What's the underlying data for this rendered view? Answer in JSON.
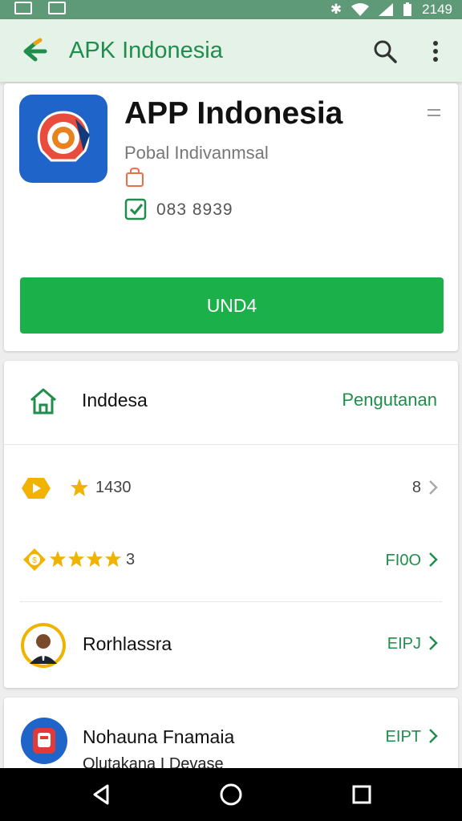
{
  "status_bar": {
    "time": "2149"
  },
  "app_bar": {
    "title": "APK Indonesia"
  },
  "app": {
    "name": "APP Indonesia",
    "publisher": "Pobal Indivanmsal",
    "size": "083 8939",
    "install_label": "UND4"
  },
  "list": {
    "header": {
      "label": "Inddesa",
      "link": "Pengutanan"
    },
    "rating_row": {
      "value": "1430",
      "count": "8"
    },
    "stars_row": {
      "value": "3",
      "link": "FI0O"
    },
    "person_row": {
      "label": "Rorhlassra",
      "link": "EIPJ"
    }
  },
  "bottom_row": {
    "label": "Nohauna Fnamaia",
    "sublabel": "Olutakana I Devase",
    "link": "EIPT"
  },
  "colors": {
    "accent_green": "#1f8e4c",
    "button_green": "#1cb04a",
    "star_yellow": "#f0b400",
    "status_green": "#5f9a78"
  }
}
